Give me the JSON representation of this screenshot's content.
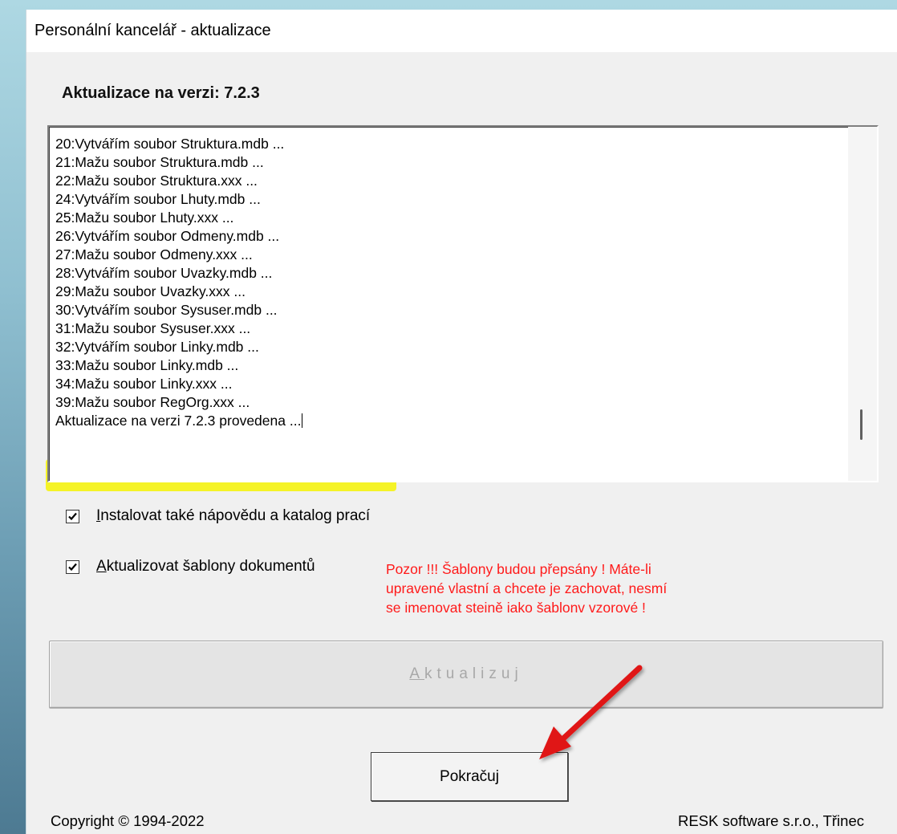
{
  "window": {
    "title": "Personální kancelář - aktualizace"
  },
  "heading": "Aktualizace na verzi: 7.2.3",
  "log": {
    "lines": [
      "20:Vytvářím soubor Struktura.mdb ...",
      "21:Mažu soubor Struktura.mdb ...",
      "22:Mažu soubor Struktura.xxx ...",
      "24:Vytvářím soubor Lhuty.mdb ...",
      "25:Mažu soubor Lhuty.xxx ...",
      "26:Vytvářím soubor Odmeny.mdb ...",
      "27:Mažu soubor Odmeny.xxx ...",
      "28:Vytvářím soubor Uvazky.mdb ...",
      "29:Mažu soubor Uvazky.xxx ...",
      "30:Vytvářím soubor Sysuser.mdb ...",
      "31:Mažu soubor Sysuser.xxx ...",
      "32:Vytvářím soubor Linky.mdb ...",
      "33:Mažu soubor Linky.mdb ...",
      "34:Mažu soubor Linky.xxx ...",
      "39:Mažu soubor RegOrg.xxx ..."
    ],
    "final_line": "Aktualizace na verzi 7.2.3 provedena ..."
  },
  "options": {
    "install_help": {
      "accel": "I",
      "label_rest": "nstalovat také nápovědu a katalog prací",
      "checked": true
    },
    "update_templates": {
      "accel": "A",
      "label_rest": "ktualizovat šablony dokumentů",
      "checked": true
    }
  },
  "warning": {
    "lines": [
      "Pozor !!! Šablony budou přepsány ! Máte-li",
      "upravené vlastní a chcete je zachovat, nesmí",
      "se imenovat steině iako šablonv vzorové !"
    ],
    "color": "#ff1a1a"
  },
  "buttons": {
    "update_accel": "A",
    "update_rest": "ktualizuj",
    "continue": "Pokračuj"
  },
  "footer": {
    "copyright": "Copyright © 1994-2022",
    "company": "RESK software s.r.o., Třinec"
  },
  "colors": {
    "highlight": "#f5f30a",
    "arrow": "#e01818",
    "disabled_text": "#a8a8a8"
  }
}
